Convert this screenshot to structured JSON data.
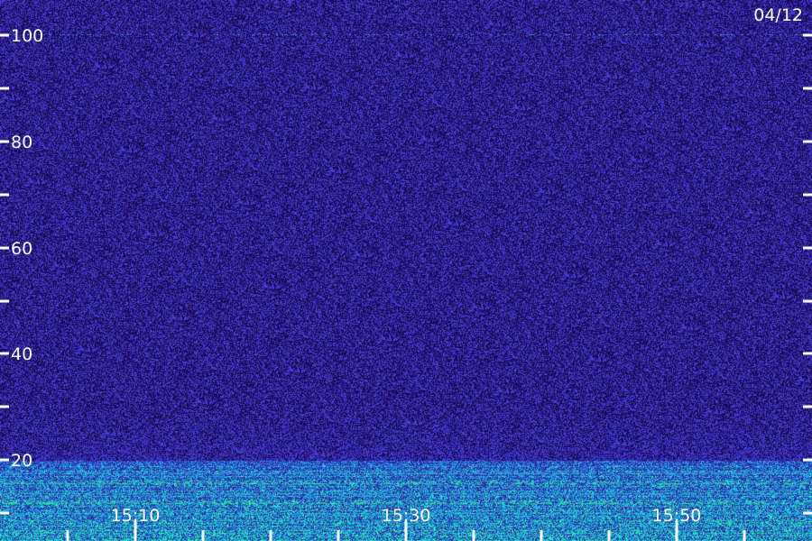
{
  "chart_data": {
    "type": "heatmap",
    "date_label": "04/12",
    "y_ticks": [
      {
        "value": 100,
        "label": "100"
      },
      {
        "value": 90,
        "label": ""
      },
      {
        "value": 80,
        "label": "80"
      },
      {
        "value": 70,
        "label": ""
      },
      {
        "value": 60,
        "label": "60"
      },
      {
        "value": 50,
        "label": ""
      },
      {
        "value": 40,
        "label": "40"
      },
      {
        "value": 30,
        "label": ""
      },
      {
        "value": 20,
        "label": "20"
      },
      {
        "value": 10,
        "label": ""
      }
    ],
    "ylim": [
      5,
      107
    ],
    "x_ticks": [
      {
        "value": "15:05",
        "label": ""
      },
      {
        "value": "15:10",
        "label": "15:10"
      },
      {
        "value": "15:15",
        "label": ""
      },
      {
        "value": "15:20",
        "label": ""
      },
      {
        "value": "15:25",
        "label": ""
      },
      {
        "value": "15:30",
        "label": "15:30"
      },
      {
        "value": "15:35",
        "label": ""
      },
      {
        "value": "15:40",
        "label": ""
      },
      {
        "value": "15:45",
        "label": ""
      },
      {
        "value": "15:50",
        "label": "15:50"
      },
      {
        "value": "15:55",
        "label": ""
      }
    ],
    "xlim": [
      "15:02",
      "15:58"
    ],
    "colors": {
      "background": "#1a0a5c",
      "noise_low": "#2a1680",
      "noise_high": "#3c2fd0",
      "signal": "#28a8e0",
      "signal_strong": "#30e890",
      "axis": "#ffffff"
    }
  }
}
